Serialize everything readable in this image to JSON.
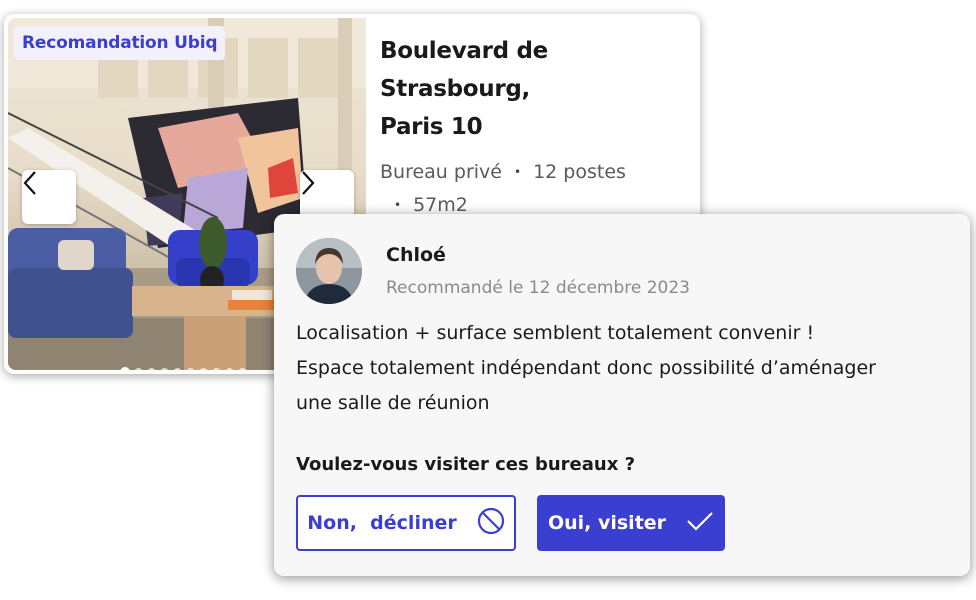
{
  "listing": {
    "badge": "Recomandation Ubiq",
    "title_line1": "Boulevard de Strasbourg,",
    "title_line2": "Paris 10",
    "type": "Bureau privé",
    "separator": "•",
    "capacity": "12 postes",
    "area": "57m2",
    "carousel": {
      "total_photos": 10,
      "active_index": 0
    },
    "icons": {
      "prev": "chevron-left-icon",
      "next": "chevron-right-icon"
    }
  },
  "comment": {
    "author": "Chloé",
    "date": "Recommandé le 12 décembre 2023",
    "lines": [
      "Localisation + surface semblent totalement convenir !",
      "Espace totalement indépendant donc possibilité d’aménager",
      "une salle de réunion"
    ],
    "question": "Voulez-vous visiter ces bureaux ?",
    "decline_label": "Non,  décliner",
    "accept_label": "Oui, visiter",
    "icons": {
      "decline": "ban-icon",
      "accept": "check-icon"
    }
  },
  "colors": {
    "accent": "#3b3fd1",
    "badge_bg": "#f1f0fb",
    "muted_text": "#8a8a8a",
    "card_bg": "#f7f7f8"
  }
}
